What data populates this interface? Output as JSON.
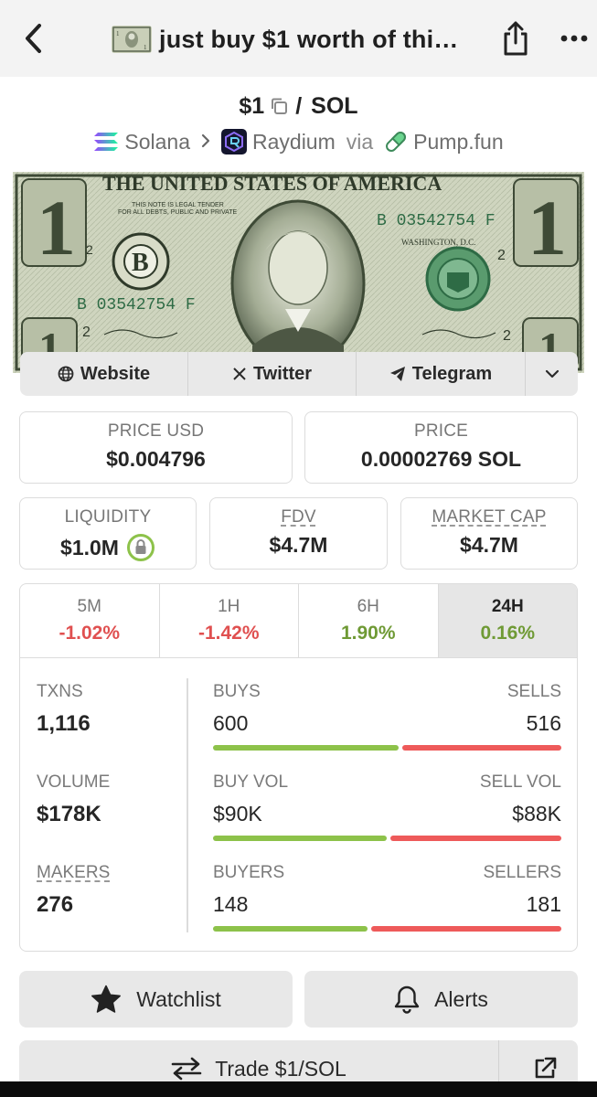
{
  "topbar": {
    "title": "just buy $1 worth of thi…",
    "icons": [
      "chevron-left-icon",
      "dollar-bill-thumbnail",
      "share-icon",
      "more-icon"
    ]
  },
  "pair": {
    "base": "$1",
    "separator": "/",
    "quote": "SOL"
  },
  "chain": {
    "network": "Solana",
    "dex": "Raydium",
    "via": "via",
    "launchpad": "Pump.fun"
  },
  "banner": {
    "heading": "THE UNITED STATES OF AMERICA",
    "serial": "B 03542754 F",
    "city": "WASHINGTON, D.C.",
    "denomination": "1",
    "seal_letter": "B"
  },
  "links": {
    "website": "Website",
    "twitter": "Twitter",
    "telegram": "Telegram"
  },
  "prices": {
    "price_usd_label": "PRICE USD",
    "price_usd_value": "$0.004796",
    "price_label": "PRICE",
    "price_value": "0.00002769 SOL",
    "liquidity_label": "LIQUIDITY",
    "liquidity_value": "$1.0M",
    "fdv_label": "FDV",
    "fdv_value": "$4.7M",
    "mcap_label": "MARKET CAP",
    "mcap_value": "$4.7M"
  },
  "tabs": [
    {
      "label": "5M",
      "value": "-1.02%",
      "trend": "down"
    },
    {
      "label": "1H",
      "value": "-1.42%",
      "trend": "down"
    },
    {
      "label": "6H",
      "value": "1.90%",
      "trend": "up"
    },
    {
      "label": "24H",
      "value": "0.16%",
      "trend": "up",
      "active": true
    }
  ],
  "stats": {
    "txns_label": "TXNS",
    "txns_value": "1,116",
    "volume_label": "VOLUME",
    "volume_value": "$178K",
    "makers_label": "MAKERS",
    "makers_value": "276",
    "buys_label": "BUYS",
    "sells_label": "SELLS",
    "buys_value": "600",
    "sells_value": "516",
    "buys_ratio": 0.537,
    "buyvol_label": "BUY VOL",
    "sellvol_label": "SELL VOL",
    "buyvol_value": "$90K",
    "sellvol_value": "$88K",
    "buyvol_ratio": 0.505,
    "buyers_label": "BUYERS",
    "sellers_label": "SELLERS",
    "buyers_value": "148",
    "sellers_value": "181",
    "buyers_ratio": 0.45
  },
  "actions": {
    "watchlist": "Watchlist",
    "alerts": "Alerts",
    "trade": "Trade $1/SOL"
  },
  "colors": {
    "buy": "#8dc24a",
    "sell": "#ee5a5a",
    "negative": "#e05050",
    "positive": "#6f9a35"
  }
}
